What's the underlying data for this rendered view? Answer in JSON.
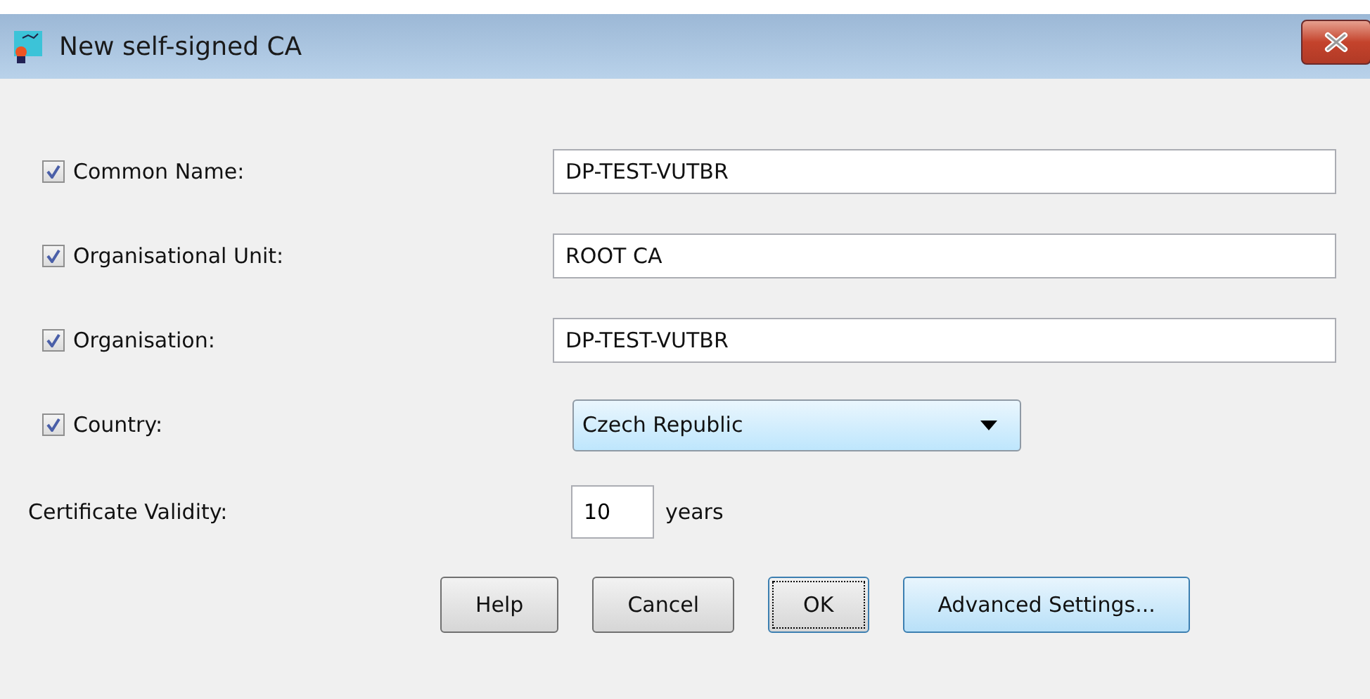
{
  "window": {
    "title": "New self-signed CA"
  },
  "fields": [
    {
      "kind": "text",
      "label": "Common Name:",
      "checked": true,
      "value": "DP-TEST-VUTBR"
    },
    {
      "kind": "text",
      "label": "Organisational Unit:",
      "checked": true,
      "value": "ROOT CA"
    },
    {
      "kind": "text",
      "label": "Organisation:",
      "checked": true,
      "value": "DP-TEST-VUTBR"
    },
    {
      "kind": "dropdown",
      "label": "Country:",
      "checked": true,
      "value": "Czech Republic"
    }
  ],
  "validity": {
    "label": "Certificate Validity:",
    "value": "10",
    "unit": "years"
  },
  "buttons": [
    {
      "label": "Help",
      "focused": false,
      "highlighted": false
    },
    {
      "label": "Cancel",
      "focused": false,
      "highlighted": false
    },
    {
      "label": "OK",
      "focused": true,
      "highlighted": false
    },
    {
      "label": "Advanced Settings...",
      "focused": false,
      "highlighted": true
    }
  ]
}
